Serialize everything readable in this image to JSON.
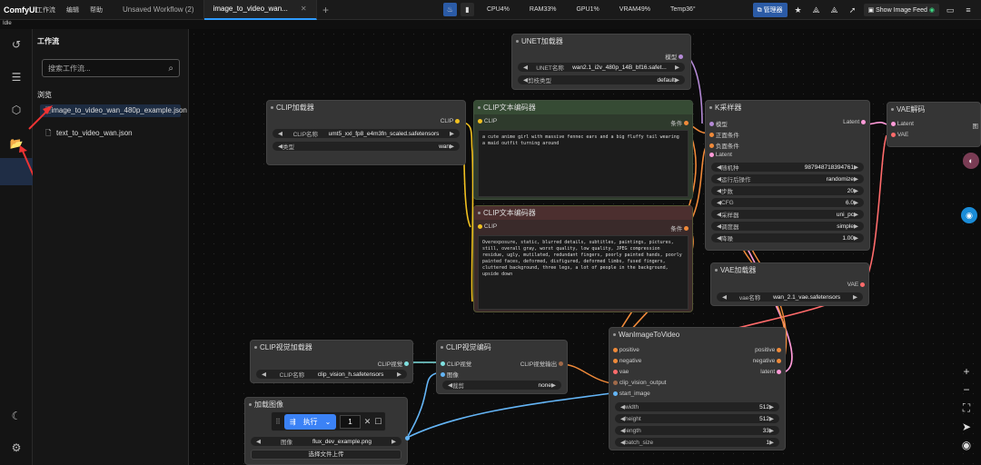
{
  "app": {
    "logo": "ComfyUI",
    "status": "Idle"
  },
  "menu": [
    "工作流",
    "编辑",
    "帮助"
  ],
  "tabs": [
    {
      "label": "Unsaved Workflow (2)"
    },
    {
      "label": "image_to_video_wan..."
    }
  ],
  "stats": {
    "cpu": "CPU4%",
    "ram": "RAM33%",
    "gpu": "GPU1%",
    "vram": "VRAM49%",
    "temp": "Temp36°"
  },
  "topbar_right": {
    "manager": "管理器",
    "feed": "Show Image Feed"
  },
  "sidebar": {
    "title": "工作流",
    "search_placeholder": "搜索工作流...",
    "browse": "浏览",
    "files": [
      "image_to_video_wan_480p_example.json",
      "text_to_video_wan.json"
    ]
  },
  "nodes": {
    "unet": {
      "title": "UNET加载器",
      "out": "模型",
      "name_label": "UNET名称",
      "name_value": "wan2.1_i2v_480p_14B_bf16.safet...",
      "dtype_label": "剪枝类型",
      "dtype_value": "default"
    },
    "clip_loader": {
      "title": "CLIP加载器",
      "out": "CLIP",
      "name_label": "CLIP名称",
      "name_value": "umt5_xxl_fp8_e4m3fn_scaled.safetensors",
      "type_label": "类型",
      "type_value": "wan"
    },
    "clip_pos": {
      "title": "CLIP文本编码器",
      "in": "CLIP",
      "out": "条件",
      "text": "a cute anime girl with massive fennec ears and a big fluffy tail wearing a maid outfit turning around"
    },
    "clip_neg": {
      "title": "CLIP文本编码器",
      "in": "CLIP",
      "out": "条件",
      "text": "Overexposure, static, blurred details, subtitles, paintings, pictures, still, overall gray, worst quality, low quality, JPEG compression residue, ugly, mutilated, redundant fingers, poorly painted hands, poorly painted faces, deformed, disfigured, deformed limbs, fused fingers, cluttered background, three legs, a lot of people in the background, upside down"
    },
    "ksampler": {
      "title": "K采样器",
      "inputs": [
        "模型",
        "正面条件",
        "负面条件",
        "Latent"
      ],
      "out": "Latent",
      "params": [
        {
          "label": "随机种",
          "value": "987948718394761"
        },
        {
          "label": "运行后操作",
          "value": "randomize"
        },
        {
          "label": "步数",
          "value": "20"
        },
        {
          "label": "CFG",
          "value": "6.0"
        },
        {
          "label": "采样器",
          "value": "uni_pc"
        },
        {
          "label": "调度器",
          "value": "simple"
        },
        {
          "label": "降噪",
          "value": "1.00"
        }
      ]
    },
    "vae_decode": {
      "title": "VAE解码",
      "inputs": [
        "Latent",
        "VAE"
      ],
      "out": "图"
    },
    "vae_loader": {
      "title": "VAE加载器",
      "out": "VAE",
      "name_label": "vae名称",
      "name_value": "wan_2.1_vae.safetensors"
    },
    "clip_vision_loader": {
      "title": "CLIP视觉加载器",
      "out": "CLIP视觉",
      "name_label": "CLIP名称",
      "name_value": "clip_vision_h.safetensors"
    },
    "clip_vision_encode": {
      "title": "CLIP视觉编码",
      "inputs": [
        "CLIP视觉",
        "图像"
      ],
      "out": "CLIP视觉输出",
      "crop_label": "裁剪",
      "crop_value": "none"
    },
    "load_image": {
      "title": "加载图像",
      "image_label": "图像",
      "image_value": "flux_dev_example.png",
      "upload": "选择文件上传"
    },
    "wan": {
      "title": "WanImageToVideo",
      "inputs": [
        "positive",
        "negative",
        "vae",
        "clip_vision_output",
        "start_image"
      ],
      "outputs": [
        "positive",
        "negative",
        "latent"
      ],
      "params": [
        {
          "label": "width",
          "value": "512"
        },
        {
          "label": "height",
          "value": "512"
        },
        {
          "label": "length",
          "value": "33"
        },
        {
          "label": "batch_size",
          "value": "1"
        }
      ]
    }
  },
  "exec": {
    "run": "执行",
    "count": "1"
  },
  "colors": {
    "accent": "#3b82f6",
    "clip_link": "#f0c020",
    "model_link": "#b48ad6",
    "cond_link": "#f08a3a",
    "latent_link": "#ff9ad8",
    "vae_link": "#ff6b6b",
    "image_link": "#64b5f6"
  }
}
